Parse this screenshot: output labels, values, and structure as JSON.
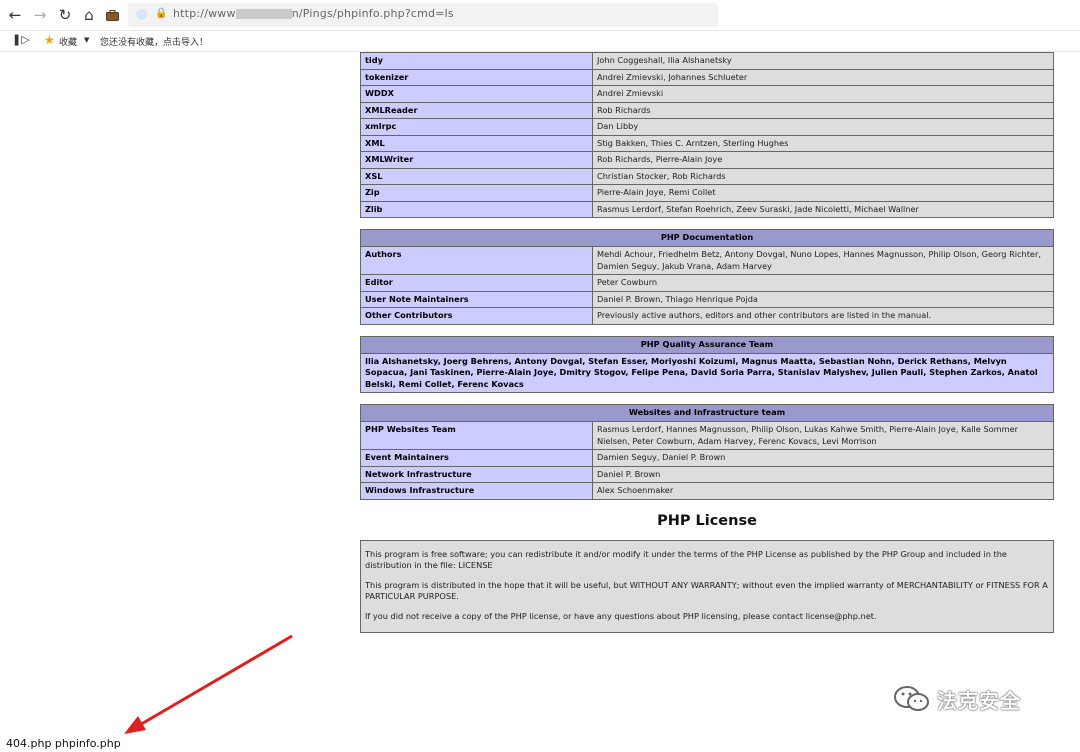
{
  "browser": {
    "url_prefix": "http://www",
    "url_suffix": "n/Pings/phpinfo.php?cmd=ls",
    "bookmarks_label": "收藏",
    "bookmarks_hint": "您还没有收藏，点击导入！"
  },
  "credits_rows": [
    {
      "name": "tidy",
      "authors": "John Coggeshall, Ilia Alshanetsky"
    },
    {
      "name": "tokenizer",
      "authors": "Andrei Zmievski, Johannes Schlueter"
    },
    {
      "name": "WDDX",
      "authors": "Andrei Zmievski"
    },
    {
      "name": "XMLReader",
      "authors": "Rob Richards"
    },
    {
      "name": "xmlrpc",
      "authors": "Dan Libby"
    },
    {
      "name": "XML",
      "authors": "Stig Bakken, Thies C. Arntzen, Sterling Hughes"
    },
    {
      "name": "XMLWriter",
      "authors": "Rob Richards, Pierre-Alain Joye"
    },
    {
      "name": "XSL",
      "authors": "Christian Stocker, Rob Richards"
    },
    {
      "name": "Zip",
      "authors": "Pierre-Alain Joye, Remi Collet"
    },
    {
      "name": "Zlib",
      "authors": "Rasmus Lerdorf, Stefan Roehrich, Zeev Suraski, Jade Nicoletti, Michael Wallner"
    }
  ],
  "documentation": {
    "title": "PHP Documentation",
    "rows": [
      {
        "name": "Authors",
        "value": "Mehdi Achour, Friedhelm Betz, Antony Dovgal, Nuno Lopes, Hannes Magnusson, Philip Olson, Georg Richter, Damien Seguy, Jakub Vrana, Adam Harvey"
      },
      {
        "name": "Editor",
        "value": "Peter Cowburn"
      },
      {
        "name": "User Note Maintainers",
        "value": "Daniel P. Brown, Thiago Henrique Pojda"
      },
      {
        "name": "Other Contributors",
        "value": "Previously active authors, editors and other contributors are listed in the manual."
      }
    ]
  },
  "qa_team": {
    "title": "PHP Quality Assurance Team",
    "members": "Ilia Alshanetsky, Joerg Behrens, Antony Dovgal, Stefan Esser, Moriyoshi Koizumi, Magnus Maatta, Sebastian Nohn, Derick Rethans, Melvyn Sopacua, Jani Taskinen, Pierre-Alain Joye, Dmitry Stogov, Felipe Pena, David Soria Parra, Stanislav Malyshev, Julien Pauli, Stephen Zarkos, Anatol Belski, Remi Collet, Ferenc Kovacs"
  },
  "websites": {
    "title": "Websites and Infrastructure team",
    "rows": [
      {
        "name": "PHP Websites Team",
        "value": "Rasmus Lerdorf, Hannes Magnusson, Philip Olson, Lukas Kahwe Smith, Pierre-Alain Joye, Kalle Sommer Nielsen, Peter Cowburn, Adam Harvey, Ferenc Kovacs, Levi Morrison"
      },
      {
        "name": "Event Maintainers",
        "value": "Damien Seguy, Daniel P. Brown"
      },
      {
        "name": "Network Infrastructure",
        "value": "Daniel P. Brown"
      },
      {
        "name": "Windows Infrastructure",
        "value": "Alex Schoenmaker"
      }
    ]
  },
  "license": {
    "title": "PHP License",
    "p1": "This program is free software; you can redistribute it and/or modify it under the terms of the PHP License as published by the PHP Group and included in the distribution in the file: LICENSE",
    "p2": "This program is distributed in the hope that it will be useful, but WITHOUT ANY WARRANTY; without even the implied warranty of MERCHANTABILITY or FITNESS FOR A PARTICULAR PURPOSE.",
    "p3": "If you did not receive a copy of the PHP license, or have any questions about PHP licensing, please contact license@php.net."
  },
  "status_output": "404.php phpinfo.php",
  "watermark": "法克安全",
  "colors": {
    "header": "#9999cc",
    "key_cell": "#ccccff",
    "value_cell": "#dddddd",
    "arrow": "#e02020"
  }
}
